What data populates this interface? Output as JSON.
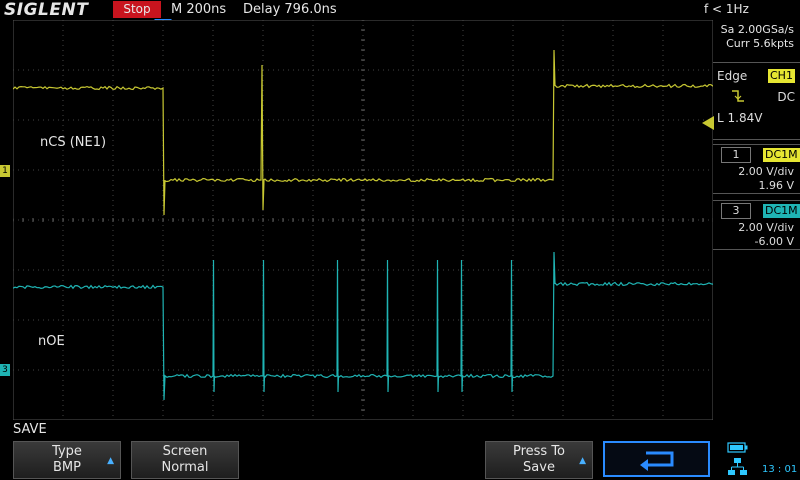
{
  "header": {
    "brand": "SIGLENT",
    "run_state": "Stop",
    "timebase": "M 200ns",
    "delay": "Delay 796.0ns",
    "frequency": "f < 1Hz"
  },
  "acquisition": {
    "sample_rate": "Sa 2.00GSa/s",
    "memory": "Curr 5.6kpts"
  },
  "trigger": {
    "type": "Edge",
    "source": "CH1",
    "coupling": "DC",
    "level": "L  1.84V"
  },
  "channels": [
    {
      "id": "1",
      "coupling": "DC1M",
      "scale": "2.00 V/div",
      "offset": "1.96 V",
      "color": "#c8c832"
    },
    {
      "id": "3",
      "coupling": "DC1M",
      "scale": "2.00 V/div",
      "offset": "-6.00 V",
      "color": "#1fb4b4"
    }
  ],
  "signal_labels": {
    "ch1": "nCS (NE1)",
    "ch3": "nOE"
  },
  "channel_markers": {
    "ch1": "1",
    "ch3": "3"
  },
  "menu": {
    "title": "SAVE",
    "buttons": [
      {
        "line1": "Type",
        "line2": "BMP"
      },
      {
        "line1": "Screen",
        "line2": "Normal"
      },
      {
        "line1": "Press To",
        "line2": "Save"
      }
    ]
  },
  "status": {
    "time": "13 : 01"
  },
  "icons": {
    "back": "return-arrow-icon",
    "battery": "battery-icon",
    "network": "network-icon"
  }
}
